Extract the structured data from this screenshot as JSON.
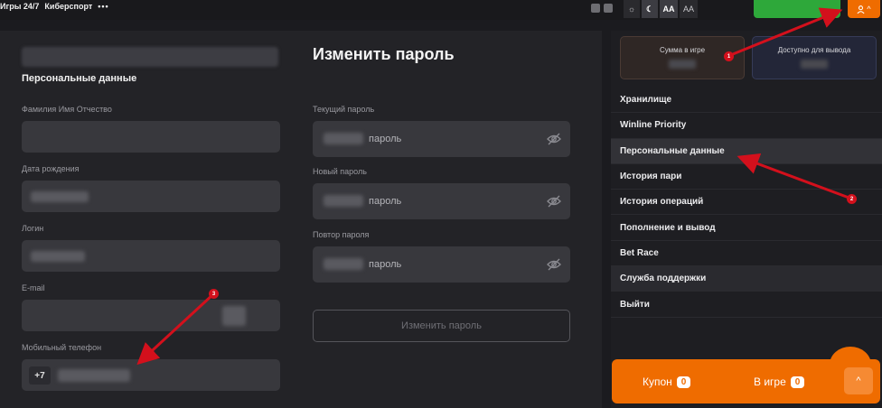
{
  "topbar": {
    "nav": [
      "Игры 24/7",
      "Киберспорт"
    ],
    "more": "•••",
    "theme": {
      "sun": "☼",
      "moon": "☾",
      "font_large": "AA",
      "font_small": "AA"
    },
    "user_arrow": "^"
  },
  "personal": {
    "title": "Персональные данные",
    "fields": {
      "fio": {
        "label": "Фамилия Имя Отчество"
      },
      "dob": {
        "label": "Дата рождения"
      },
      "login": {
        "label": "Логин"
      },
      "email": {
        "label": "E-mail"
      },
      "phone": {
        "label": "Мобильный телефон",
        "prefix": "+7"
      }
    }
  },
  "password": {
    "title": "Изменить пароль",
    "current": {
      "label": "Текущий пароль",
      "placeholder": "пароль"
    },
    "new": {
      "label": "Новый пароль",
      "placeholder": "пароль"
    },
    "repeat": {
      "label": "Повтор пароля",
      "placeholder": "пароль"
    },
    "submit": "Изменить пароль"
  },
  "balance": {
    "in_game": "Сумма в игре",
    "available": "Доступно для вывода"
  },
  "menu": [
    "Хранилище",
    "Winline Priority",
    "Персональные данные",
    "История пари",
    "История операций",
    "Пополнение и вывод",
    "Bet Race",
    "Служба поддержки",
    "Выйти"
  ],
  "coupon": {
    "label": "Купон",
    "count": "0",
    "ingame_label": "В игре",
    "ingame_count": "0"
  },
  "annotations": {
    "n1": "1",
    "n2": "2",
    "n3": "3"
  },
  "colors": {
    "accent": "#ef6c00",
    "annotation": "#d3101c",
    "green": "#2ea83a"
  }
}
